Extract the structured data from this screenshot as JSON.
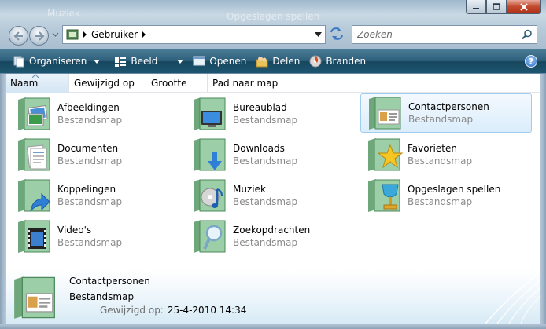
{
  "window": {
    "background_titles": [
      "Muziek",
      "Opgeslagen spellen"
    ],
    "caption_buttons": [
      "minimize",
      "maximize",
      "close"
    ]
  },
  "address_bar": {
    "crumbs": [
      "Gebruiker"
    ],
    "search_placeholder": "Zoeken"
  },
  "toolbar": {
    "organize": "Organiseren",
    "views": "Beeld",
    "open": "Openen",
    "share": "Delen",
    "burn": "Branden",
    "help": "?"
  },
  "columns": [
    "Naam",
    "Gewijzigd op",
    "Grootte",
    "Pad naar map"
  ],
  "items": [
    {
      "name": "Afbeeldingen",
      "type": "Bestandsmap",
      "icon": "pictures-folder-icon"
    },
    {
      "name": "Bureaublad",
      "type": "Bestandsmap",
      "icon": "desktop-folder-icon"
    },
    {
      "name": "Contactpersonen",
      "type": "Bestandsmap",
      "icon": "contacts-folder-icon",
      "selected": true
    },
    {
      "name": "Documenten",
      "type": "Bestandsmap",
      "icon": "documents-folder-icon"
    },
    {
      "name": "Downloads",
      "type": "Bestandsmap",
      "icon": "downloads-folder-icon"
    },
    {
      "name": "Favorieten",
      "type": "Bestandsmap",
      "icon": "favorites-folder-icon"
    },
    {
      "name": "Koppelingen",
      "type": "Bestandsmap",
      "icon": "links-folder-icon"
    },
    {
      "name": "Muziek",
      "type": "Bestandsmap",
      "icon": "music-folder-icon"
    },
    {
      "name": "Opgeslagen spellen",
      "type": "Bestandsmap",
      "icon": "saved-games-folder-icon"
    },
    {
      "name": "Video's",
      "type": "Bestandsmap",
      "icon": "videos-folder-icon"
    },
    {
      "name": "Zoekopdrachten",
      "type": "Bestandsmap",
      "icon": "searches-folder-icon"
    }
  ],
  "details": {
    "name": "Contactpersonen",
    "type": "Bestandsmap",
    "modified_label": "Gewijzigd op:",
    "modified_value": "25-4-2010 14:34"
  },
  "colors": {
    "toolbar": "#2d5f7b",
    "selection_border": "#9fcdf0",
    "selection_fill": "#dbedfb",
    "secondary_text": "#8a8a8a"
  }
}
